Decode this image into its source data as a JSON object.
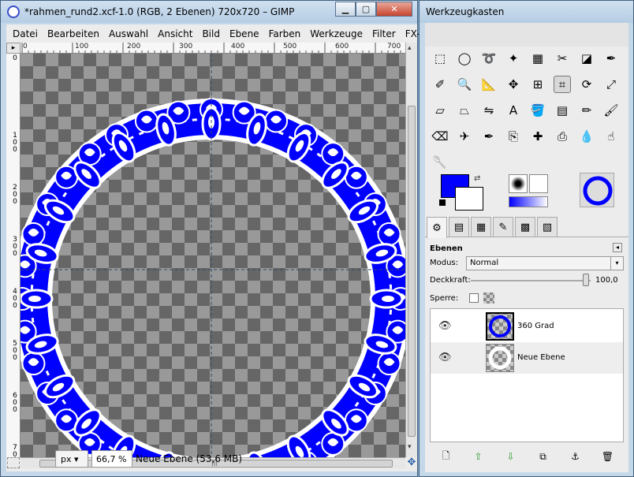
{
  "image_window": {
    "title": "*rahmen_rund2.xcf-1.0 (RGB, 2 Ebenen) 720x720 – GIMP",
    "menu": [
      "Datei",
      "Bearbeiten",
      "Auswahl",
      "Ansicht",
      "Bild",
      "Ebene",
      "Farben",
      "Werkzeuge",
      "Filter",
      "FX-Foun"
    ],
    "hruler_labels": [
      "0",
      "100",
      "200",
      "300",
      "400",
      "500",
      "600",
      "700"
    ],
    "vruler_labels": [
      "0",
      "100",
      "200",
      "300",
      "400",
      "500",
      "600",
      "700"
    ],
    "status": {
      "unit": "px",
      "zoom": "66,7 %",
      "layer_info": "Neue Ebene (53,6 MB)"
    },
    "frame_color": "#0000ff"
  },
  "toolbox": {
    "title": "Werkzeugkasten",
    "tools": [
      "rect-select-icon",
      "ellipse-select-icon",
      "free-select-icon",
      "fuzzy-select-icon",
      "select-by-color-icon",
      "scissors-icon",
      "foreground-select-icon",
      "paths-icon",
      "color-picker-icon",
      "zoom-icon",
      "measure-icon",
      "move-icon",
      "align-icon",
      "crop-icon",
      "rotate-icon",
      "scale-icon",
      "shear-icon",
      "perspective-icon",
      "flip-icon",
      "text-icon",
      "bucket-fill-icon",
      "blend-icon",
      "pencil-icon",
      "paintbrush-icon",
      "eraser-icon",
      "airbrush-icon",
      "ink-icon",
      "clone-icon",
      "heal-icon",
      "perspective-clone-icon",
      "blur-icon",
      "smudge-icon",
      "dodge-burn-icon"
    ],
    "fg_color": "#0000ff",
    "bg_color": "#ffffff"
  },
  "layers_panel": {
    "title": "Ebenen",
    "mode_label": "Modus:",
    "mode_value": "Normal",
    "opacity_label": "Deckkraft:",
    "opacity_value": "100,0",
    "lock_label": "Sperre:",
    "layers": [
      {
        "name": "360 Grad",
        "selected": true
      },
      {
        "name": "Neue Ebene",
        "selected": false
      }
    ]
  }
}
